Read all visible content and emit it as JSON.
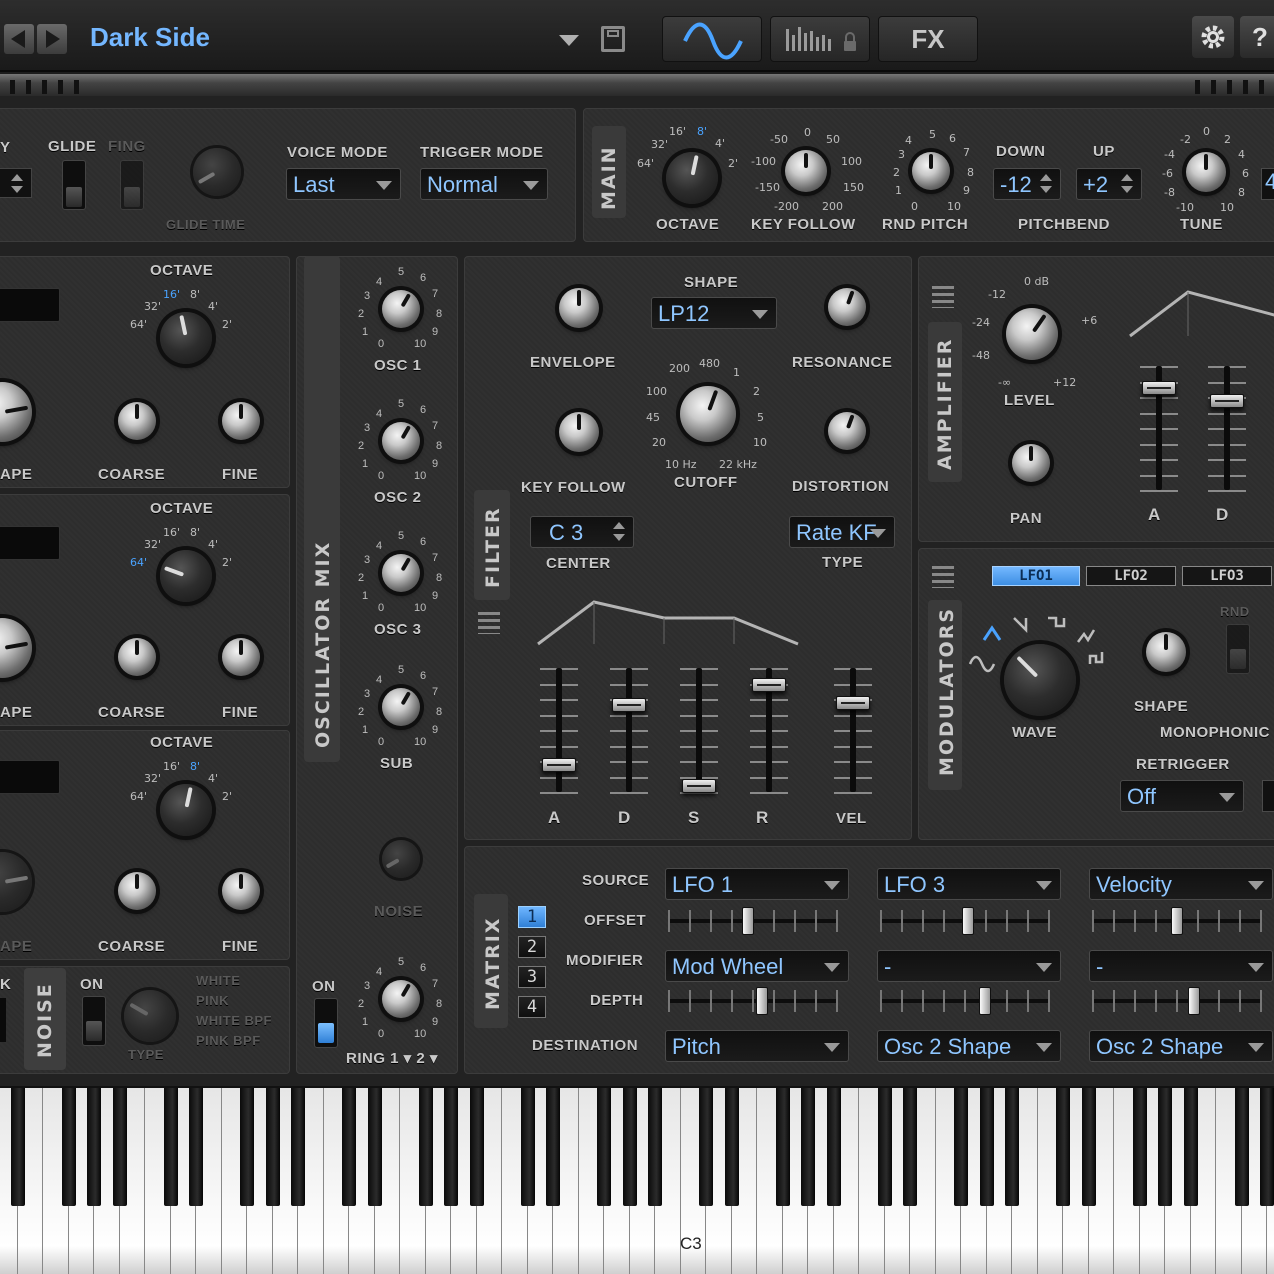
{
  "header": {
    "preset_name": "Dark Side",
    "fx_label": "FX",
    "help_label": "?"
  },
  "top": {
    "glide_label": "GLIDE",
    "fing_label": "FING",
    "glide_time_label": "GLIDE TIME",
    "voice_mode_label": "VOICE MODE",
    "voice_mode_value": "Last",
    "trigger_mode_label": "TRIGGER MODE",
    "trigger_mode_value": "Normal",
    "left_cut_label": "Y"
  },
  "main": {
    "tab_label": "MAIN",
    "octave_label": "OCTAVE",
    "octave_ticks": [
      "16'",
      "8'",
      "4'",
      "2'",
      "32'",
      "64'"
    ],
    "key_follow_label": "KEY FOLLOW",
    "key_follow_ticks": [
      "-50",
      "0",
      "50",
      "-100",
      "100",
      "-150",
      "150",
      "-200",
      "200"
    ],
    "rnd_pitch_label": "RND PITCH",
    "pitchbend_label": "PITCHBEND",
    "down_label": "DOWN",
    "down_value": "-12",
    "up_label": "UP",
    "up_value": "+2",
    "tune_label": "TUNE",
    "tune_ticks": [
      "-2",
      "0",
      "2",
      "-4",
      "4",
      "-6",
      "6",
      "-8",
      "8",
      "-10",
      "10"
    ],
    "edge_value": "4"
  },
  "osc": {
    "octave_label": "OCTAVE",
    "coarse_label": "COARSE",
    "fine_label": "FINE",
    "shape_label_cut": "APE",
    "oct_ticks_a": [
      "16'",
      "8'",
      "4'",
      "2'",
      "32'",
      "64'"
    ]
  },
  "osc_mix": {
    "tab_label": "OSCILLATOR MIX",
    "osc1": "OSC 1",
    "osc2": "OSC 2",
    "osc3": "OSC 3",
    "sub": "SUB",
    "noise": "NOISE",
    "on_label": "ON",
    "ring_label": "RING 1 ▾  2 ▾"
  },
  "noise": {
    "tab_label": "NOISE",
    "on_label": "ON",
    "type_label": "TYPE",
    "types": [
      "WHITE",
      "PINK",
      "WHITE BPF",
      "PINK BPF"
    ],
    "left_cut": "K"
  },
  "filter": {
    "tab_label": "FILTER",
    "envelope_label": "ENVELOPE",
    "shape_label": "SHAPE",
    "shape_value": "LP12",
    "resonance_label": "RESONANCE",
    "key_follow_label": "KEY FOLLOW",
    "cutoff_label": "CUTOFF",
    "distortion_label": "DISTORTION",
    "center_label": "CENTER",
    "center_value": "C  3",
    "type_label": "TYPE",
    "type_value": "Rate KF",
    "cutoff_ticks": [
      "200",
      "480",
      "100",
      "1",
      "45",
      "2",
      "20",
      "5",
      "10",
      "10 Hz",
      "22 kHz"
    ],
    "adsr": [
      "A",
      "D",
      "S",
      "R"
    ],
    "vel_label": "VEL",
    "adsr_levels": [
      0.22,
      0.7,
      0.05,
      0.86
    ],
    "vel_level": 0.72
  },
  "amp": {
    "tab_label": "AMPLIFIER",
    "level_label": "LEVEL",
    "level_ticks": [
      "0 dB",
      "-12",
      "+6",
      "-24",
      "-48",
      "-∞",
      "+12"
    ],
    "pan_label": "PAN",
    "a_label": "A",
    "d_label": "D",
    "a_level": 0.82,
    "d_level": 0.72
  },
  "modulators": {
    "tab_label": "MODULATORS",
    "lfo_tabs": [
      "LFO1",
      "LFO2",
      "LFO3"
    ],
    "wave_label": "WAVE",
    "shape_label": "SHAPE",
    "rnd_label": "RND",
    "monophonic_label": "MONOPHONIC",
    "retrigger_label": "RETRIGGER",
    "retrigger_value": "Off"
  },
  "matrix": {
    "tab_label": "MATRIX",
    "row_labels": [
      "SOURCE",
      "OFFSET",
      "MODIFIER",
      "DEPTH",
      "DESTINATION"
    ],
    "slot_buttons": [
      "1",
      "2",
      "3",
      "4"
    ],
    "slots": [
      {
        "source": "LFO 1",
        "modifier": "Mod Wheel",
        "destination": "Pitch",
        "offset": 0.47,
        "depth": 0.55
      },
      {
        "source": "LFO 3",
        "modifier": "-",
        "destination": "Osc 2 Shape",
        "offset": 0.52,
        "depth": 0.62
      },
      {
        "source": "Velocity",
        "modifier": "-",
        "destination": "Osc 2 Shape",
        "offset": 0.5,
        "depth": 0.6
      }
    ]
  },
  "keyboard": {
    "c3_label": "C3"
  },
  "colors": {
    "accent": "#4aa3ff",
    "panel": "#2e2e2e",
    "background": "#1c1c1c"
  }
}
